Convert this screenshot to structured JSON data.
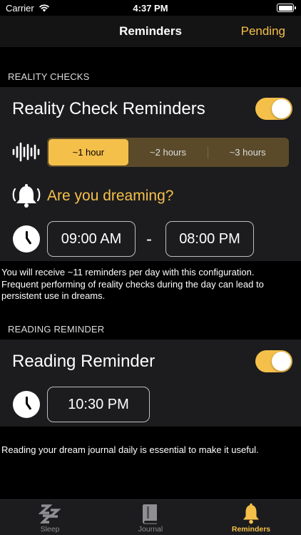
{
  "status": {
    "carrier": "Carrier",
    "time": "4:37 PM"
  },
  "nav": {
    "title": "Reminders",
    "action": "Pending"
  },
  "reality": {
    "header": "REALITY CHECKS",
    "title": "Reality Check Reminders",
    "enabled": true,
    "intervals": [
      "~1 hour",
      "~2 hours",
      "~3 hours"
    ],
    "selected_interval": "~1 hour",
    "question": "Are you dreaming?",
    "start_time": "09:00 AM",
    "separator": "-",
    "end_time": "08:00 PM",
    "note": "You will receive ~11 reminders per day with this configuration. Frequent performing of reality checks during the day can lead to persistent use in dreams."
  },
  "reading": {
    "header": "READING REMINDER",
    "title": "Reading Reminder",
    "enabled": true,
    "time": "10:30 PM",
    "note": "Reading your dream journal daily is essential to make it useful."
  },
  "tabs": [
    {
      "label": "Sleep",
      "icon": "zzz-icon",
      "active": false
    },
    {
      "label": "Journal",
      "icon": "book-icon",
      "active": false
    },
    {
      "label": "Reminders",
      "icon": "bell-icon",
      "active": true
    }
  ],
  "colors": {
    "accent": "#f5c04a",
    "background": "#000000",
    "card": "#1c1c1e"
  }
}
